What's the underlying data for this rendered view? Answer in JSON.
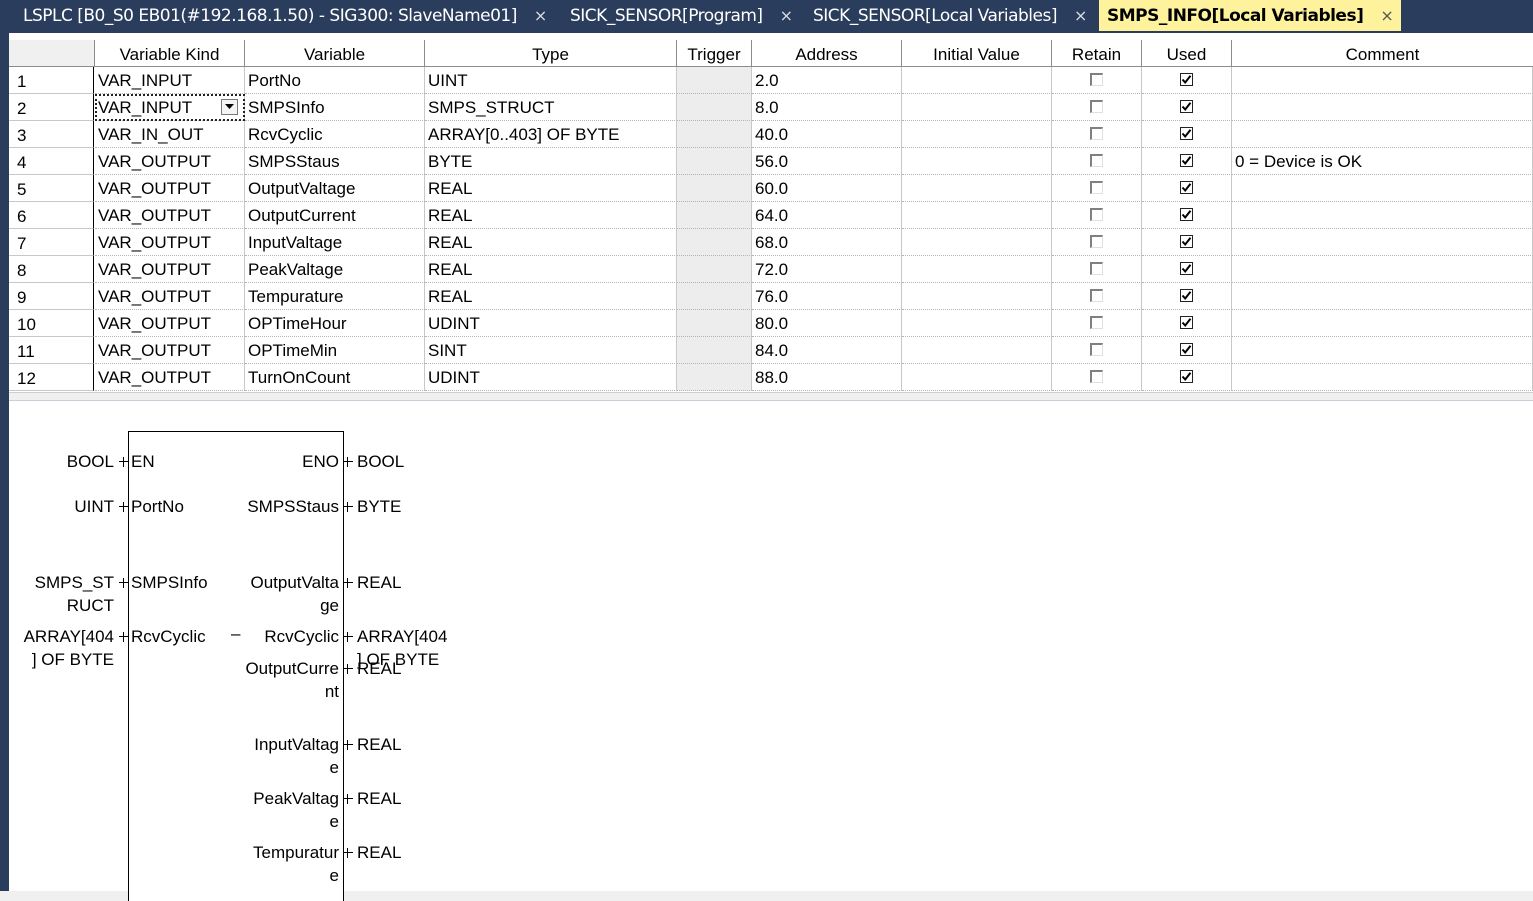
{
  "tabs": [
    {
      "label": "LSPLC [B0_S0 EB01(#192.168.1.50) - SIG300: SlaveName01]",
      "close": "×"
    },
    {
      "label": "SICK_SENSOR[Program]",
      "close": "×"
    },
    {
      "label": "SICK_SENSOR[Local Variables]",
      "close": "×"
    },
    {
      "label": "SMPS_INFO[Local Variables]",
      "close": "×",
      "active": true
    }
  ],
  "table": {
    "headers": {
      "kind": "Variable Kind",
      "variable": "Variable",
      "type": "Type",
      "trigger": "Trigger",
      "address": "Address",
      "initial": "Initial Value",
      "retain": "Retain",
      "used": "Used",
      "comment": "Comment"
    },
    "rows": [
      {
        "no": "1",
        "kind": "VAR_INPUT",
        "variable": "PortNo",
        "type": "UINT",
        "trigger": "",
        "address": "2.0",
        "initial": "",
        "retain": false,
        "used": true,
        "comment": ""
      },
      {
        "no": "2",
        "kind": "VAR_INPUT",
        "variable": "SMPSInfo",
        "type": "SMPS_STRUCT",
        "trigger": "",
        "address": "8.0",
        "initial": "",
        "retain": false,
        "used": true,
        "comment": ""
      },
      {
        "no": "3",
        "kind": "VAR_IN_OUT",
        "variable": "RcvCyclic",
        "type": "ARRAY[0..403] OF BYTE",
        "trigger": "",
        "address": "40.0",
        "initial": "",
        "retain": false,
        "used": true,
        "comment": ""
      },
      {
        "no": "4",
        "kind": "VAR_OUTPUT",
        "variable": "SMPSStaus",
        "type": "BYTE",
        "trigger": "",
        "address": "56.0",
        "initial": "",
        "retain": false,
        "used": true,
        "comment": "0 = Device is OK"
      },
      {
        "no": "5",
        "kind": "VAR_OUTPUT",
        "variable": "OutputValtage",
        "type": "REAL",
        "trigger": "",
        "address": "60.0",
        "initial": "",
        "retain": false,
        "used": true,
        "comment": ""
      },
      {
        "no": "6",
        "kind": "VAR_OUTPUT",
        "variable": "OutputCurrent",
        "type": "REAL",
        "trigger": "",
        "address": "64.0",
        "initial": "",
        "retain": false,
        "used": true,
        "comment": ""
      },
      {
        "no": "7",
        "kind": "VAR_OUTPUT",
        "variable": "InputValtage",
        "type": "REAL",
        "trigger": "",
        "address": "68.0",
        "initial": "",
        "retain": false,
        "used": true,
        "comment": ""
      },
      {
        "no": "8",
        "kind": "VAR_OUTPUT",
        "variable": "PeakValtage",
        "type": "REAL",
        "trigger": "",
        "address": "72.0",
        "initial": "",
        "retain": false,
        "used": true,
        "comment": ""
      },
      {
        "no": "9",
        "kind": "VAR_OUTPUT",
        "variable": "Tempurature",
        "type": "REAL",
        "trigger": "",
        "address": "76.0",
        "initial": "",
        "retain": false,
        "used": true,
        "comment": ""
      },
      {
        "no": "10",
        "kind": "VAR_OUTPUT",
        "variable": "OPTimeHour",
        "type": "UDINT",
        "trigger": "",
        "address": "80.0",
        "initial": "",
        "retain": false,
        "used": true,
        "comment": ""
      },
      {
        "no": "11",
        "kind": "VAR_OUTPUT",
        "variable": "OPTimeMin",
        "type": "SINT",
        "trigger": "",
        "address": "84.0",
        "initial": "",
        "retain": false,
        "used": true,
        "comment": ""
      },
      {
        "no": "12",
        "kind": "VAR_OUTPUT",
        "variable": "TurnOnCount",
        "type": "UDINT",
        "trigger": "",
        "address": "88.0",
        "initial": "",
        "retain": false,
        "used": true,
        "comment": ""
      }
    ]
  },
  "block": {
    "left_types": [
      "BOOL",
      "UINT",
      "SMPS_ST",
      "RUCT",
      "ARRAY[404",
      "] OF BYTE"
    ],
    "inputs": [
      "EN",
      "PortNo",
      "SMPSInfo",
      "RcvCyclic"
    ],
    "dash": "–",
    "outputs": [
      "ENO",
      "SMPSStaus",
      "OutputValta",
      "ge",
      "RcvCyclic",
      "OutputCurre",
      "nt",
      "InputValtag",
      "e",
      "PeakValtag",
      "e",
      "Tempuratur",
      "e"
    ],
    "right_types": [
      "BOOL",
      "BYTE",
      "REAL",
      "ARRAY[404",
      "] OF BYTE",
      "REAL",
      "REAL",
      "REAL",
      "REAL"
    ]
  },
  "colors": {
    "tabbar": "#2b3d5c",
    "active_tab": "#fff29d",
    "cell_gray": "#ededed"
  }
}
